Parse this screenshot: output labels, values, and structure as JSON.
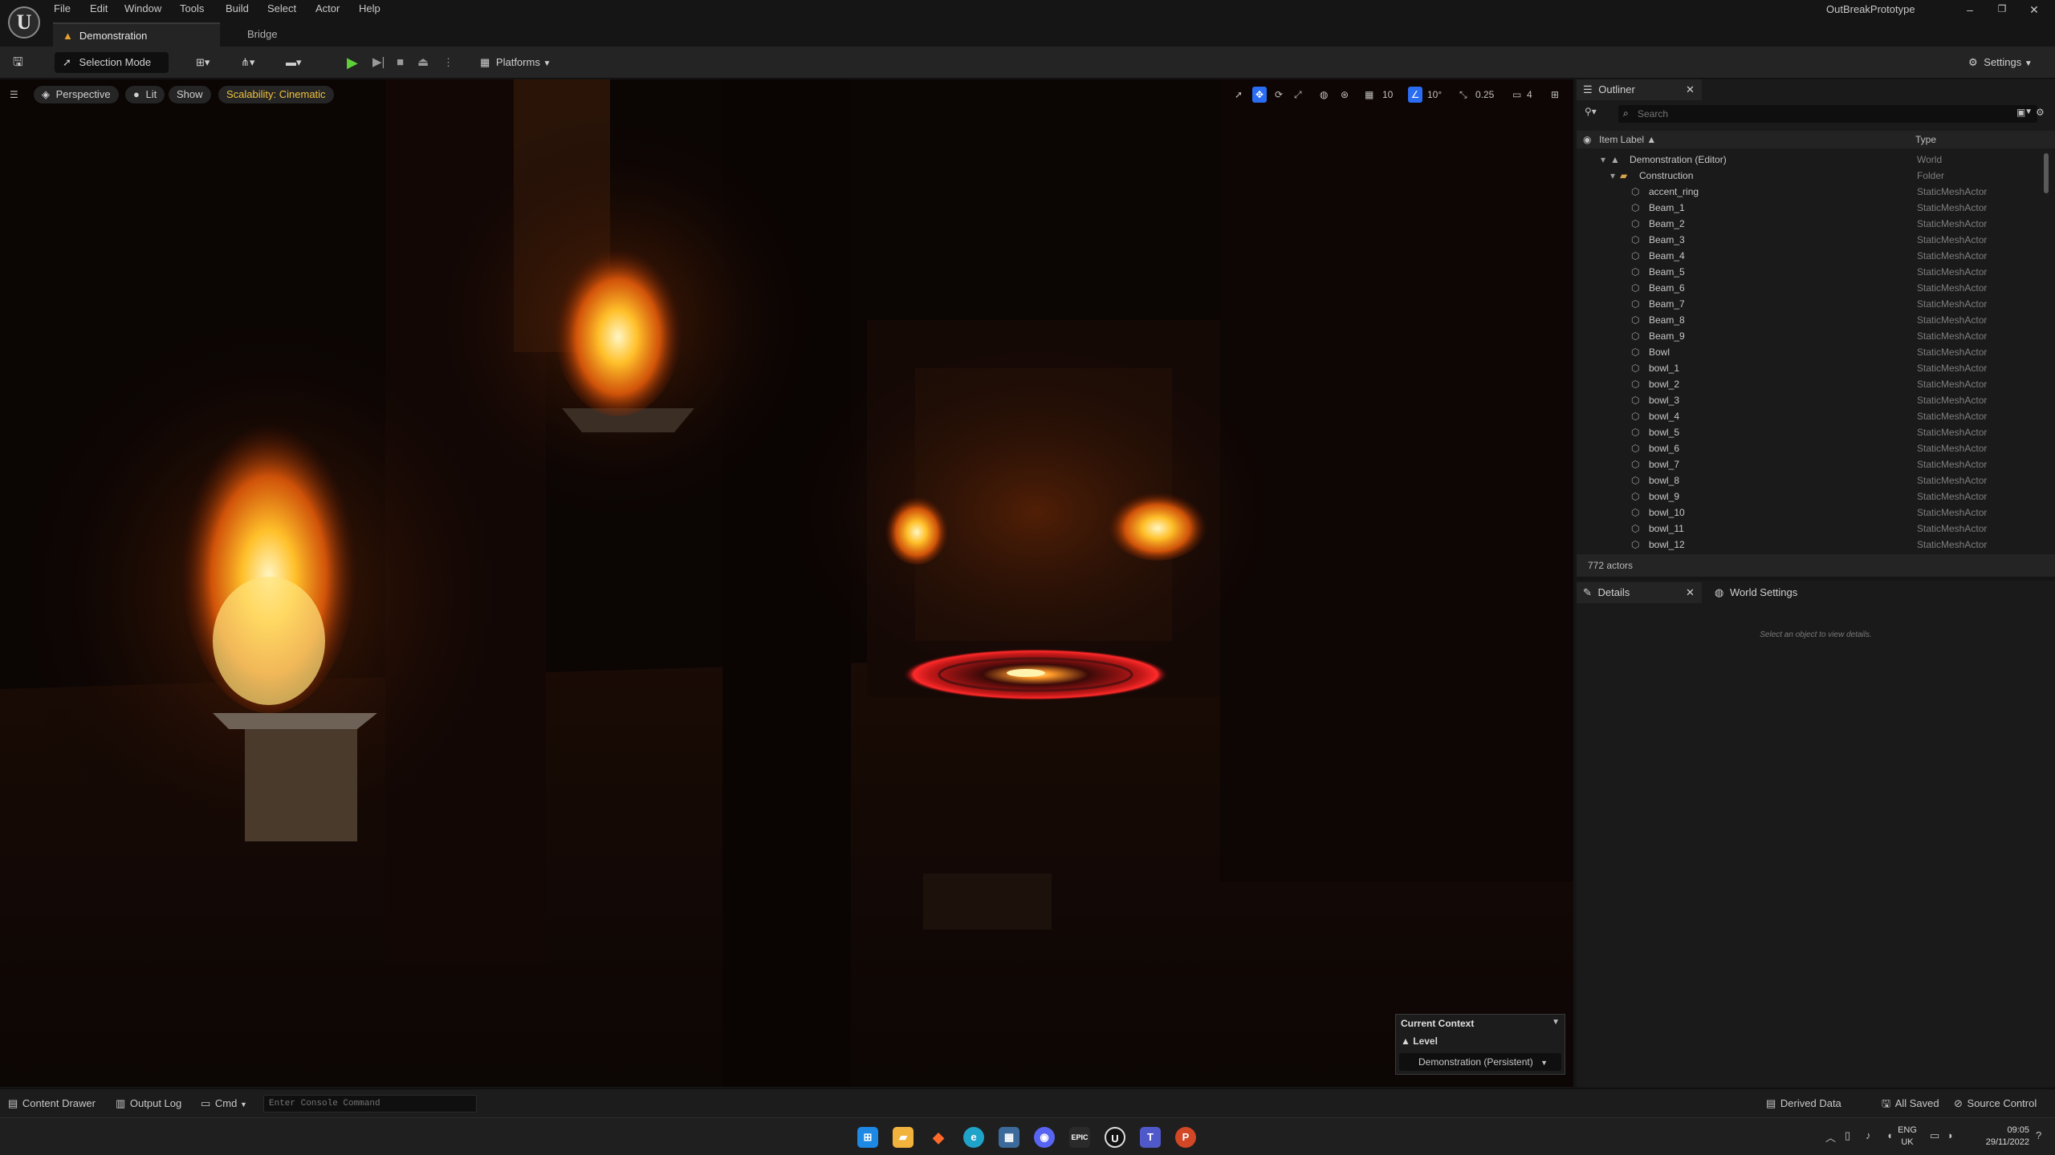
{
  "menu": [
    "File",
    "Edit",
    "Window",
    "Tools",
    "Build",
    "Select",
    "Actor",
    "Help"
  ],
  "tabs": {
    "active": "Demonstration",
    "other": "Bridge"
  },
  "project_name": "OutBreakPrototype",
  "toolbar": {
    "selection_mode": "Selection Mode",
    "platforms": "Platforms",
    "settings": "Settings"
  },
  "viewport": {
    "perspective": "Perspective",
    "lit": "Lit",
    "show": "Show",
    "scalability": "Scalability: Cinematic",
    "grid_snap": "10",
    "rotation_snap": "10°",
    "scale_snap": "0.25",
    "camera_speed": "4"
  },
  "outliner": {
    "title": "Outliner",
    "search_placeholder": "Search",
    "col_label": "Item Label",
    "col_type": "Type",
    "rows": [
      {
        "label": "Demonstration (Editor)",
        "type": "World"
      },
      {
        "label": "Construction",
        "type": "Folder"
      },
      {
        "label": "accent_ring",
        "type": "StaticMeshActor"
      },
      {
        "label": "Beam_1",
        "type": "StaticMeshActor"
      },
      {
        "label": "Beam_2",
        "type": "StaticMeshActor"
      },
      {
        "label": "Beam_3",
        "type": "StaticMeshActor"
      },
      {
        "label": "Beam_4",
        "type": "StaticMeshActor"
      },
      {
        "label": "Beam_5",
        "type": "StaticMeshActor"
      },
      {
        "label": "Beam_6",
        "type": "StaticMeshActor"
      },
      {
        "label": "Beam_7",
        "type": "StaticMeshActor"
      },
      {
        "label": "Beam_8",
        "type": "StaticMeshActor"
      },
      {
        "label": "Beam_9",
        "type": "StaticMeshActor"
      },
      {
        "label": "Bowl",
        "type": "StaticMeshActor"
      },
      {
        "label": "bowl_1",
        "type": "StaticMeshActor"
      },
      {
        "label": "bowl_2",
        "type": "StaticMeshActor"
      },
      {
        "label": "bowl_3",
        "type": "StaticMeshActor"
      },
      {
        "label": "bowl_4",
        "type": "StaticMeshActor"
      },
      {
        "label": "bowl_5",
        "type": "StaticMeshActor"
      },
      {
        "label": "bowl_6",
        "type": "StaticMeshActor"
      },
      {
        "label": "bowl_7",
        "type": "StaticMeshActor"
      },
      {
        "label": "bowl_8",
        "type": "StaticMeshActor"
      },
      {
        "label": "bowl_9",
        "type": "StaticMeshActor"
      },
      {
        "label": "bowl_10",
        "type": "StaticMeshActor"
      },
      {
        "label": "bowl_11",
        "type": "StaticMeshActor"
      },
      {
        "label": "bowl_12",
        "type": "StaticMeshActor"
      }
    ],
    "count": "772 actors"
  },
  "details": {
    "tab": "Details",
    "world_tab": "World Settings",
    "empty": "Select an object to view details."
  },
  "context": {
    "title": "Current Context",
    "level_label": "Level",
    "level_value": "Demonstration (Persistent)"
  },
  "bottombar": {
    "content_drawer": "Content Drawer",
    "output_log": "Output Log",
    "cmd": "Cmd",
    "console_placeholder": "Enter Console Command",
    "derived_data": "Derived Data",
    "all_saved": "All Saved",
    "source_control": "Source Control"
  },
  "taskbar": {
    "lang1": "ENG",
    "lang2": "UK",
    "time": "09:05",
    "date": "29/11/2022"
  },
  "colors": {
    "accent": "#2a6df2",
    "play": "#5fcf3a",
    "fire": "#ffb21e",
    "ring": "#ff1f1f"
  }
}
